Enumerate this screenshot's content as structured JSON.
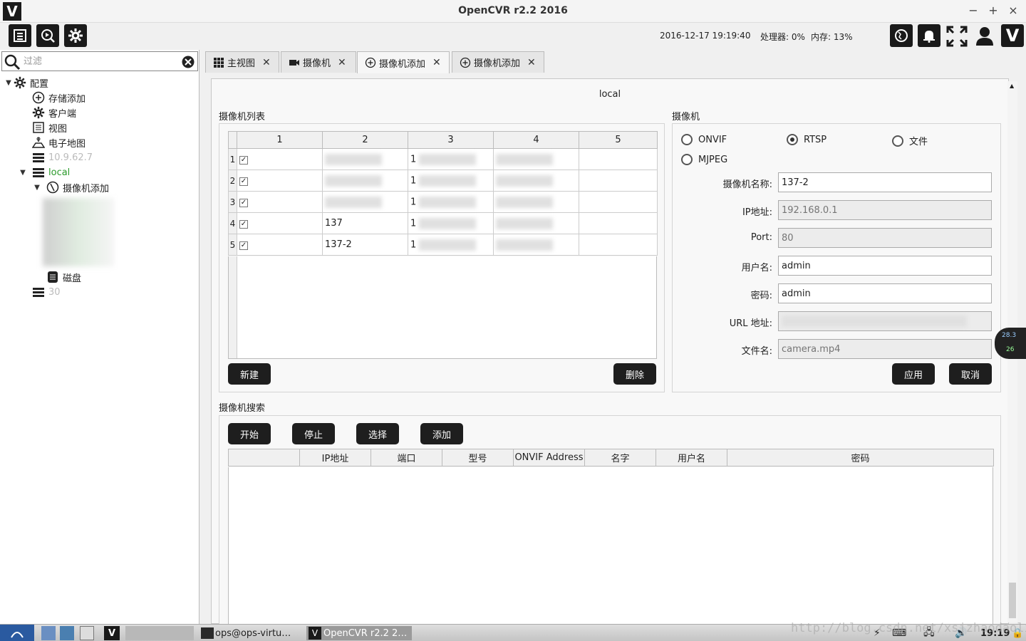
{
  "window": {
    "title": "OpenCVR r2.2 2016",
    "minimize": "−",
    "maximize": "+",
    "close": "×"
  },
  "toolbar": {
    "datetime": "2016-12-17 19:19:40",
    "cpu": "处理器: 0%",
    "mem": "内存: 13%"
  },
  "left": {
    "filter_placeholder": "过滤",
    "tree": {
      "config": "配置",
      "storage_add": "存储添加",
      "client": "客户端",
      "view": "视图",
      "emap": "电子地图",
      "server1": "10.9.62.7",
      "local": "local",
      "camera_add": "摄像机添加",
      "disk": "磁盘",
      "server2": "30"
    }
  },
  "tabs": [
    {
      "label": "主视图",
      "close": "✕"
    },
    {
      "label": "摄像机",
      "close": "✕"
    },
    {
      "label": "摄像机添加",
      "close": "✕"
    },
    {
      "label": "摄像机添加",
      "close": "✕"
    }
  ],
  "main": {
    "server_label": "local",
    "camera_list_title": "摄像机列表",
    "camera_list": {
      "columns": [
        "1",
        "2",
        "3",
        "4",
        "5"
      ],
      "rows": [
        {
          "num": "1",
          "checked": "✓",
          "name": "",
          "col3": "1"
        },
        {
          "num": "2",
          "checked": "✓",
          "name": "",
          "col3": "1"
        },
        {
          "num": "3",
          "checked": "✓",
          "name": "",
          "col3": "1"
        },
        {
          "num": "4",
          "checked": "✓",
          "name": "137",
          "col3": "1"
        },
        {
          "num": "5",
          "checked": "✓",
          "name": "137-2",
          "col3": "1"
        }
      ],
      "new_button": "新建",
      "delete_button": "删除"
    },
    "camera_title": "摄像机",
    "camera_form": {
      "radio_onvif": "ONVIF",
      "radio_rtsp": "RTSP",
      "radio_file": "文件",
      "radio_mjpeg": "MJPEG",
      "name_label": "摄像机名称:",
      "name_value": "137-2",
      "ip_label": "IP地址:",
      "ip_placeholder": "192.168.0.1",
      "port_label": "Port:",
      "port_placeholder": "80",
      "user_label": "用户名:",
      "user_value": "admin",
      "pass_label": "密码:",
      "pass_value": "admin",
      "url_label": "URL 地址:",
      "file_label": "文件名:",
      "file_placeholder": "camera.mp4",
      "apply_button": "应用",
      "cancel_button": "取消"
    },
    "search_title": "摄像机搜索",
    "search": {
      "start_button": "开始",
      "stop_button": "停止",
      "select_button": "选择",
      "add_button": "添加",
      "columns": [
        "",
        "IP地址",
        "端口",
        "型号",
        "ONVIF Address",
        "名字",
        "用户名",
        "密码"
      ]
    }
  },
  "netspeed": {
    "up": "28.3",
    "down": "26"
  },
  "taskbar": {
    "terminal": "ops@ops-virtu…",
    "app": "OpenCVR r2.2 2…",
    "clock": "19:19"
  },
  "watermark": "http://blog.csdn.net/xsjzhaodaoli"
}
